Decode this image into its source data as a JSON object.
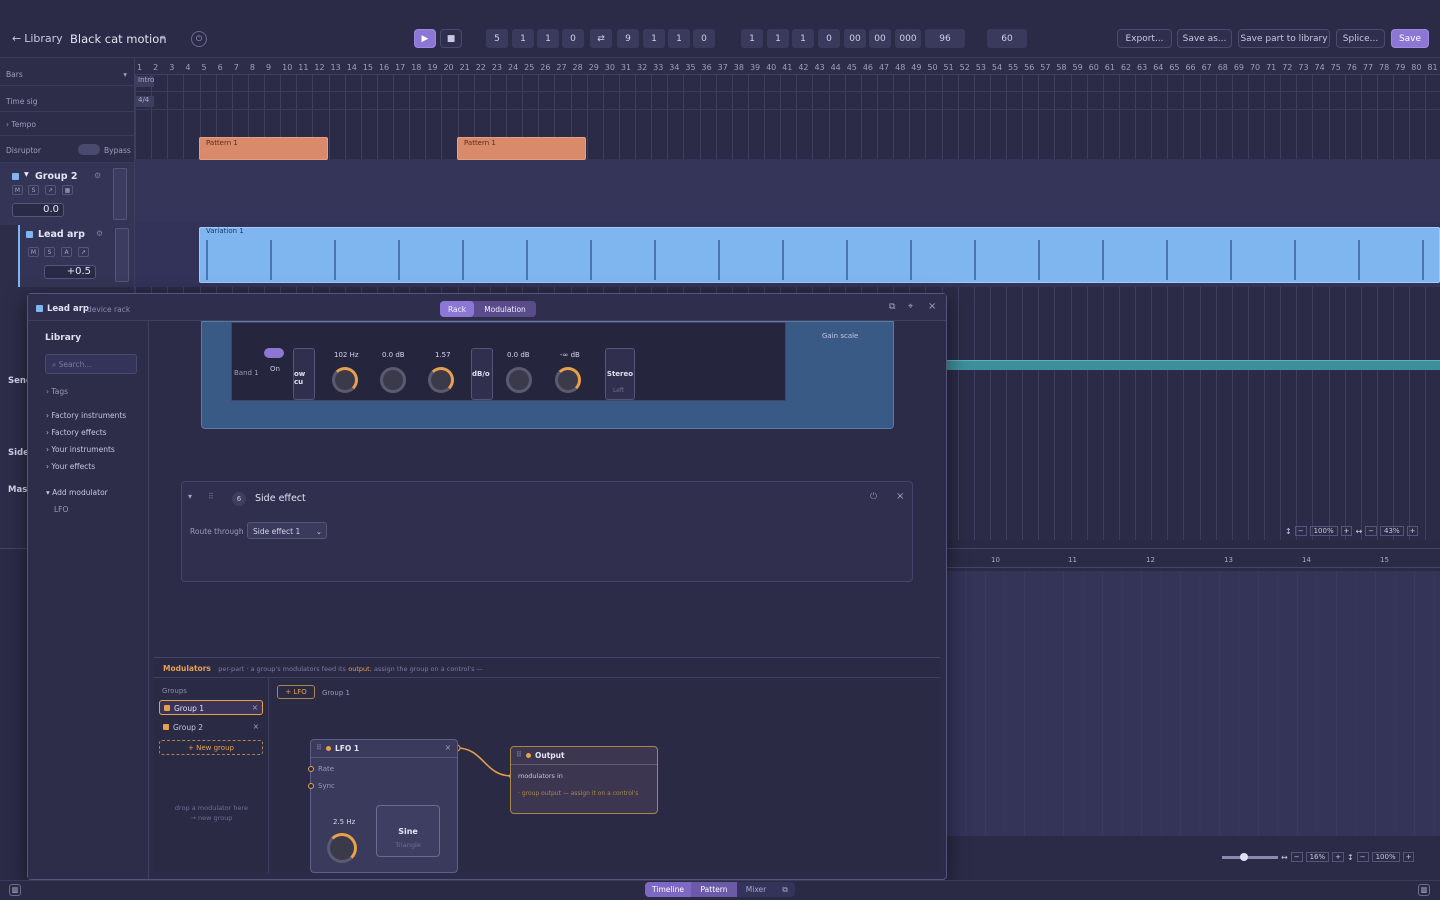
{
  "topbar": {
    "back_label": "Library",
    "project_title": "Black cat motion",
    "counters_a": [
      "5",
      "1",
      "1",
      "0"
    ],
    "counters_b": [
      "9",
      "1",
      "1",
      "0"
    ],
    "counters_c": [
      "1",
      "1",
      "1",
      "0",
      "00",
      "00",
      "000",
      "96"
    ],
    "tempo": "60",
    "export_label": "Export...",
    "save_as_label": "Save as...",
    "save_library_label": "Save part to library",
    "splice_label": "Splice...",
    "save_label": "Save"
  },
  "ruler": {
    "markers": [
      "1",
      "2",
      "3",
      "4",
      "5",
      "6",
      "7",
      "8",
      "9",
      "10",
      "11",
      "12",
      "13",
      "14",
      "15",
      "16",
      "17",
      "18",
      "19",
      "20",
      "21",
      "22",
      "23",
      "24",
      "25",
      "26",
      "27",
      "28",
      "29",
      "30",
      "31",
      "32",
      "33",
      "34",
      "35",
      "36",
      "37",
      "38",
      "39",
      "40",
      "41",
      "42",
      "43",
      "44",
      "45",
      "46",
      "47",
      "48",
      "49",
      "50",
      "51",
      "52",
      "53",
      "54",
      "55",
      "56",
      "57",
      "58",
      "59",
      "60",
      "61",
      "62",
      "63",
      "64",
      "65",
      "66",
      "67",
      "68",
      "69",
      "70",
      "71",
      "72",
      "73",
      "74",
      "75",
      "76",
      "77",
      "78",
      "79",
      "80",
      "81"
    ],
    "intro_label": "Intro",
    "timesig_value": "4/4"
  },
  "tracks": {
    "bars_label": "Bars",
    "timesig_label": "Time sig",
    "tempo_label": "Tempo",
    "disruptor_label": "Disruptor",
    "bypass_label": "Bypass",
    "group2_label": "Group 2",
    "group2_value": "0.0",
    "leadarp_label": "Lead arp",
    "leadarp_value": "+0.5",
    "btn_m": "M",
    "btn_s": "S",
    "btn_a": "A",
    "pattern_label": "Pattern 1",
    "variation_label": "Variation 1",
    "send_label": "Send",
    "side_label": "Side",
    "master_label": "Mast"
  },
  "zoom": {
    "upper_v": "100%",
    "upper_h": "43%",
    "lower_h": "16%",
    "lower_v": "100%"
  },
  "lower_ruler": [
    "10",
    "11",
    "12",
    "13",
    "14",
    "15"
  ],
  "rack": {
    "title": "Lead arp",
    "subtitle": "device rack",
    "tab_rack": "Rack",
    "tab_modulation": "Modulation",
    "library_label": "Library",
    "search_placeholder": "Search...",
    "tags_label": "Tags",
    "lib_items": [
      "Factory instruments",
      "Factory effects",
      "Your instruments",
      "Your effects"
    ],
    "add_modulator_label": "Add modulator",
    "lfo_label": "LFO",
    "eq": {
      "band_label": "Band 1",
      "on_label": "On",
      "freq": "102 Hz",
      "gain": "0.0 dB",
      "q": "1.57",
      "slope_label": "dB/o",
      "gain2": "0.0 dB",
      "thresh": "-∞ dB",
      "stereo_label": "Stereo",
      "left_label": "Left",
      "low_cut_label": "ow cu",
      "gain_scale_label": "Gain scale"
    },
    "side_effect": {
      "index": "6",
      "title": "Side effect",
      "route_label": "Route through",
      "route_value": "Side effect 1"
    },
    "modulators": {
      "title": "Modulators",
      "desc_a": "per-part · a group's modulators feed its",
      "desc_output": "output",
      "desc_b": "; assign the group on a control's —",
      "groups_label": "Groups",
      "groups": [
        "Group 1",
        "Group 2"
      ],
      "new_group_label": "+ New group",
      "drop_hint_1": "drop a modulator here",
      "drop_hint_2": "→ new group",
      "add_lfo_label": "+ LFO",
      "current_group": "Group 1",
      "lfo_node": {
        "title": "LFO 1",
        "rate_label": "Rate",
        "sync_label": "Sync",
        "rate_value": "2.5 Hz",
        "wave_value": "Sine",
        "wave_next": "Triangle"
      },
      "output_node": {
        "title": "Output",
        "in_label": "modulators in",
        "hint": "· group output — assign it on a control's"
      }
    }
  },
  "bottom_tabs": [
    "Timeline",
    "Pattern",
    "Mixer"
  ],
  "colors": {
    "accent": "#8f7ad6",
    "orange": "#e8a14a",
    "pattern": "#d98a6a",
    "arp": "#7fb6f0"
  }
}
